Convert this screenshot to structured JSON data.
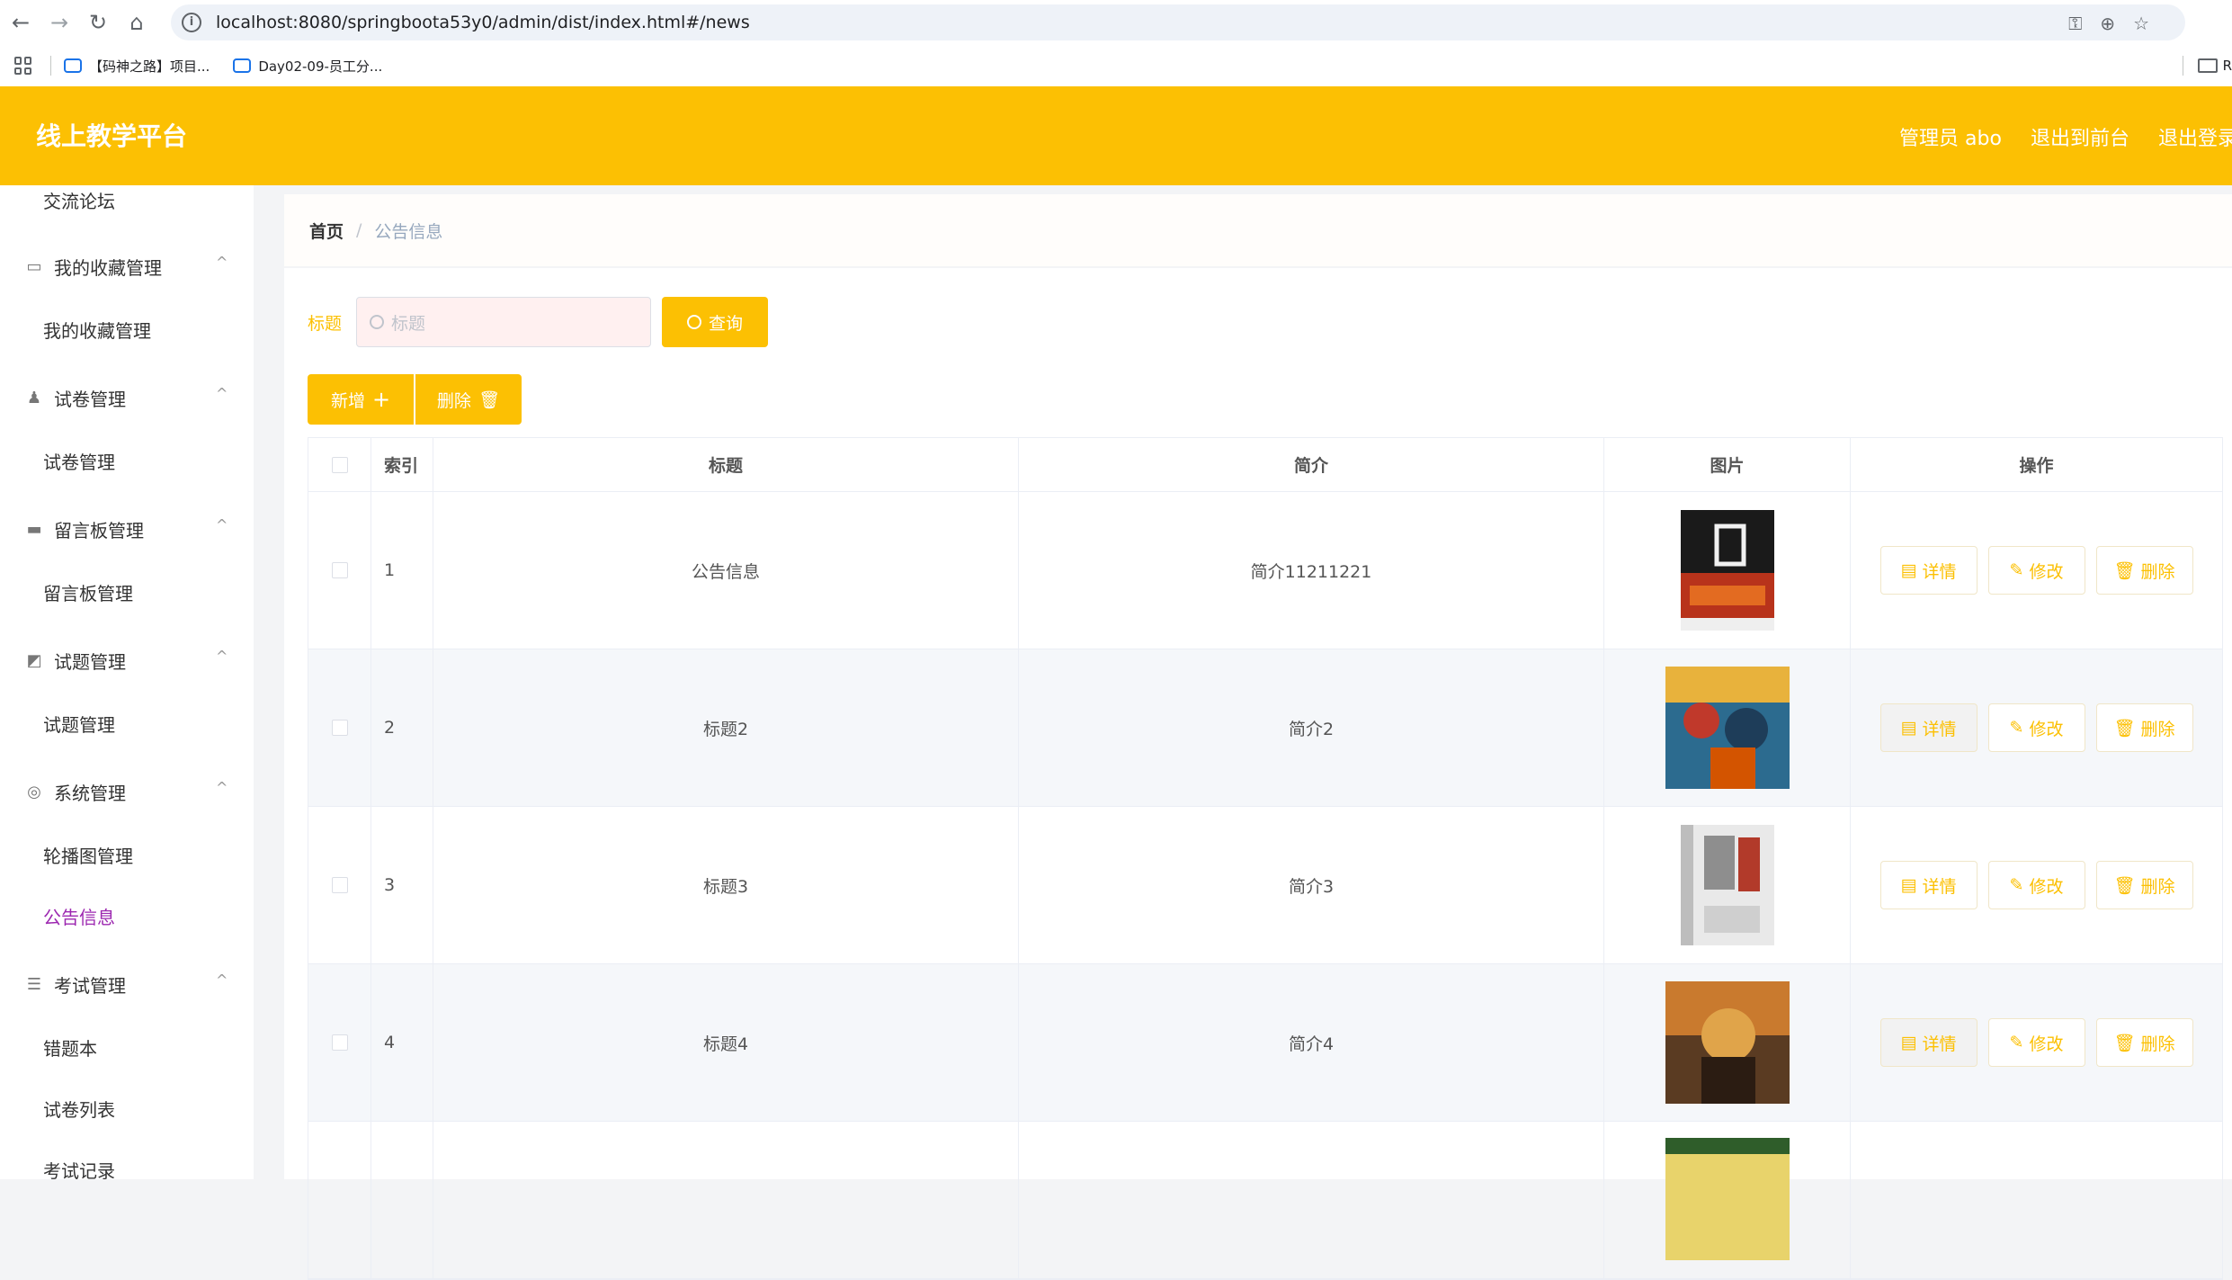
{
  "browser": {
    "url": "localhost:8080/springboota53y0/admin/dist/index.html#/news",
    "bookmarks": [
      "【码神之路】项目...",
      "Day02-09-员工分..."
    ],
    "right_folder": "R"
  },
  "header": {
    "app_title": "线上教学平台",
    "user_label": "管理员 abo",
    "to_front": "退出到前台",
    "logout": "退出登录"
  },
  "sidebar": {
    "top_item": "交流论坛",
    "groups": [
      {
        "label": "我的收藏管理",
        "icon": "id-card-icon",
        "children": [
          "我的收藏管理"
        ]
      },
      {
        "label": "试卷管理",
        "icon": "user-icon",
        "children": [
          "试卷管理"
        ]
      },
      {
        "label": "留言板管理",
        "icon": "monitor-icon",
        "children": [
          "留言板管理"
        ]
      },
      {
        "label": "试题管理",
        "icon": "chart-icon",
        "children": [
          "试题管理"
        ]
      },
      {
        "label": "系统管理",
        "icon": "lifebuoy-icon",
        "children": [
          "轮播图管理",
          "公告信息"
        ]
      },
      {
        "label": "考试管理",
        "icon": "list-icon",
        "children": [
          "错题本",
          "试卷列表",
          "考试记录"
        ]
      }
    ],
    "active_item": "公告信息"
  },
  "breadcrumb": {
    "home": "首页",
    "current": "公告信息"
  },
  "search": {
    "label": "标题",
    "placeholder": "标题",
    "button": "查询"
  },
  "toolbar": {
    "add": "新增",
    "delete": "删除"
  },
  "table": {
    "headers": [
      "索引",
      "标题",
      "简介",
      "图片",
      "操作"
    ],
    "rows": [
      {
        "index": "1",
        "title": "公告信息",
        "desc": "简介11211221"
      },
      {
        "index": "2",
        "title": "标题2",
        "desc": "简介2"
      },
      {
        "index": "3",
        "title": "标题3",
        "desc": "简介3"
      },
      {
        "index": "4",
        "title": "标题4",
        "desc": "简介4"
      }
    ],
    "actions": {
      "detail": "详情",
      "edit": "修改",
      "remove": "删除"
    }
  },
  "colors": {
    "accent": "#fcc003",
    "active_link": "#9c27b0"
  }
}
